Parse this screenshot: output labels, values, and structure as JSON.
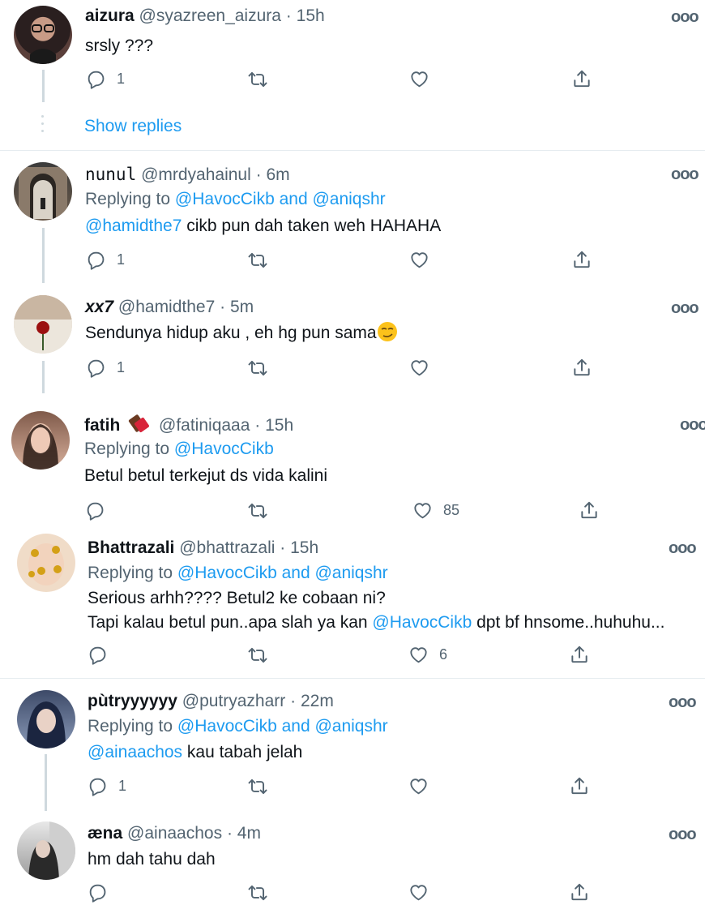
{
  "tweets": [
    {
      "name": "aizura",
      "handle": "@syazreen_aizura",
      "time": "15h",
      "text": "srsly ???",
      "counts": {
        "reply": "1",
        "retweet": "",
        "like": ""
      },
      "show_replies": "Show replies"
    },
    {
      "name": "nunul",
      "handle": "@mrdyahainul",
      "time": "6m",
      "replying_label": "Replying to",
      "replying_users": "@HavocCikb and @aniqshr",
      "mention": "@hamidthe7",
      "text": " cikb pun dah taken weh HAHAHA",
      "counts": {
        "reply": "1",
        "retweet": "",
        "like": ""
      }
    },
    {
      "name": "xx7",
      "handle": "@hamidthe7",
      "time": "5m",
      "text": "Sendunya hidup aku , eh hg pun sama",
      "counts": {
        "reply": "1",
        "retweet": "",
        "like": ""
      }
    },
    {
      "name": "fatih",
      "handle": "@fatiniqaaa",
      "time": "15h",
      "replying_label": "Replying to",
      "replying_users": "@HavocCikb",
      "text": "Betul betul terkejut ds vida kalini",
      "counts": {
        "reply": "",
        "retweet": "",
        "like": "85"
      }
    },
    {
      "name": "Bhattrazali",
      "handle": "@bhattrazali",
      "time": "15h",
      "replying_label": "Replying to",
      "replying_users": "@HavocCikb and @aniqshr",
      "text_line1": "Serious arhh???? Betul2 ke cobaan ni?",
      "text_line2_a": "Tapi kalau betul pun..apa slah ya kan ",
      "text_line2_mention": "@HavocCikb",
      "text_line2_b": " dpt bf hnsome..huhuhu...",
      "counts": {
        "reply": "",
        "retweet": "",
        "like": "6"
      }
    },
    {
      "name": "pùtryyyyyy",
      "handle": "@putryazharr",
      "time": "22m",
      "replying_label": "Replying to",
      "replying_users": "@HavocCikb and @aniqshr",
      "mention": "@ainaachos",
      "text": " kau tabah jelah",
      "counts": {
        "reply": "1",
        "retweet": "",
        "like": ""
      }
    },
    {
      "name": "æna",
      "handle": "@ainaachos",
      "time": "4m",
      "text": "hm dah tahu dah",
      "counts": {
        "reply": "",
        "retweet": "",
        "like": ""
      }
    }
  ],
  "ui": {
    "dot": "·",
    "more": "ooo"
  },
  "colors": {
    "accent": "#1d9bf0",
    "muted": "#536471",
    "text": "#0f1419"
  }
}
